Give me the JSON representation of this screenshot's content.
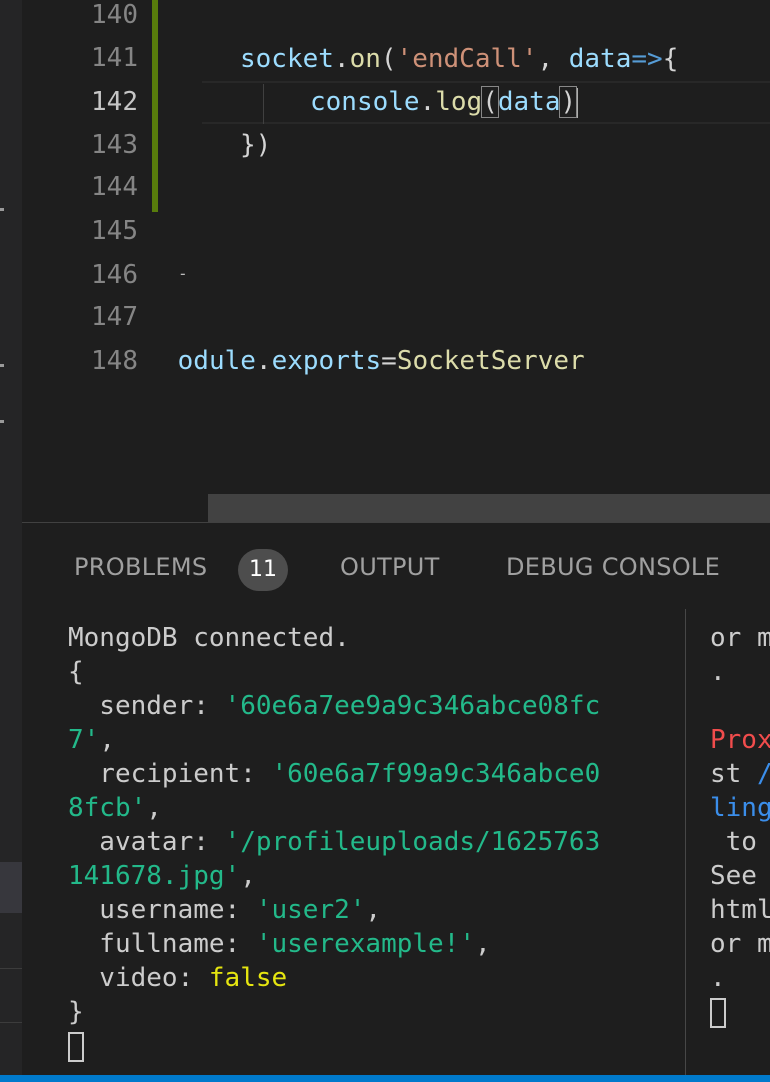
{
  "editor": {
    "line_numbers": [
      "140",
      "141",
      "142",
      "143",
      "144",
      "145",
      "146",
      "147",
      "148"
    ],
    "active_line": "142",
    "lines": {
      "l141": {
        "obj": "socket",
        "dot": ".",
        "method": "on",
        "open": "(",
        "str": "'endCall'",
        "comma": ", ",
        "param": "data",
        "arrow": "=>",
        "brace": "{"
      },
      "l142": {
        "obj": "console",
        "dot": ".",
        "method": "log",
        "open": "(",
        "arg": "data",
        "close": ")"
      },
      "l143": {
        "text": "})"
      },
      "l146": {
        "text": "-"
      },
      "l148": {
        "obj": "module",
        "dot": ".",
        "prop": "exports",
        "eq": "=",
        "value": "SocketServer"
      }
    }
  },
  "panel": {
    "tabs": {
      "problems": "PROBLEMS",
      "output": "OUTPUT",
      "debug_console": "DEBUG CONSOLE"
    },
    "problems_count": "11"
  },
  "terminal_left": {
    "l1": "MongoDB connected.",
    "l2": "{",
    "sender_key": "  sender: ",
    "sender_val1": "'60e6a7ee9a9c346abce08fc",
    "sender_val2": "7'",
    "recipient_key": "  recipient: ",
    "recipient_val1": "'60e6a7f99a9c346abce0",
    "recipient_val2": "8fcb'",
    "avatar_key": "  avatar: ",
    "avatar_val1": "'/profileuploads/1625763",
    "avatar_val2": "141678.jpg'",
    "username_key": "  username: ",
    "username_val": "'user2'",
    "fullname_key": "  fullname: ",
    "fullname_val": "'userexample!'",
    "video_key": "  video: ",
    "video_val": "false",
    "close": "}",
    "comma": ","
  },
  "terminal_right": {
    "r1": "or m",
    "r2": ".",
    "r4": "Prox",
    "r5a": "st ",
    "r5b": "/",
    "r6": "ling",
    "r7": " to ",
    "r8": "See ",
    "r9": "html",
    "r10": "or m",
    "r11": "."
  },
  "colors": {
    "accent": "#007acc",
    "git_modified": "#587c0c",
    "terminal_string": "#23b98a",
    "terminal_bool": "#e5e510",
    "terminal_error": "#f14c4c"
  }
}
